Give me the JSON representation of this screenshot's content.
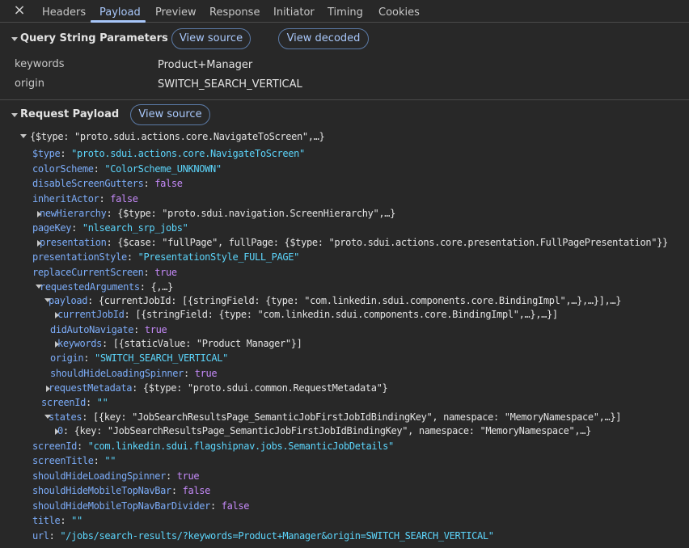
{
  "tabs": {
    "close_icon": "×",
    "items": [
      "Headers",
      "Payload",
      "Preview",
      "Response",
      "Initiator",
      "Timing",
      "Cookies"
    ],
    "active": "Payload",
    "accent": "#a8c7fa"
  },
  "query": {
    "title": "Query String Parameters",
    "view_source": "View source",
    "view_decoded": "View decoded",
    "params": [
      {
        "key": "keywords",
        "value": "Product+Manager"
      },
      {
        "key": "origin",
        "value": "SWITCH_SEARCH_VERTICAL"
      }
    ]
  },
  "payload": {
    "title": "Request Payload",
    "view_source": "View source",
    "root": "{$type: \"proto.sdui.actions.core.NavigateToScreen\",…}",
    "lines": [
      {
        "key": "$type",
        "val": "\"proto.sdui.actions.core.NavigateToScreen\"",
        "kind": "s"
      },
      {
        "key": "colorScheme",
        "val": "\"ColorScheme_UNKNOWN\"",
        "kind": "s"
      },
      {
        "key": "disableScreenGutters",
        "val": "false",
        "kind": "b"
      },
      {
        "key": "inheritActor",
        "val": "false",
        "kind": "b"
      },
      {
        "key": "newHierarchy",
        "val": "{$type: \"proto.sdui.navigation.ScreenHierarchy\",…}",
        "kind": "p"
      },
      {
        "key": "pageKey",
        "val": "\"nlsearch_srp_jobs\"",
        "kind": "s"
      },
      {
        "key": "presentation",
        "val": "{$case: \"fullPage\", fullPage: {$type: \"proto.sdui.actions.core.presentation.FullPagePresentation\"}}",
        "kind": "p"
      },
      {
        "key": "presentationStyle",
        "val": "\"PresentationStyle_FULL_PAGE\"",
        "kind": "s"
      },
      {
        "key": "replaceCurrentScreen",
        "val": "true",
        "kind": "b"
      },
      {
        "key": "requestedArguments",
        "val": "{,…}",
        "kind": "p"
      },
      {
        "key": "payload",
        "val": "{currentJobId: [{stringField: {type: \"com.linkedin.sdui.components.core.BindingImpl\",…},…}],…}",
        "kind": "p"
      },
      {
        "key": "currentJobId",
        "val": "[{stringField: {type: \"com.linkedin.sdui.components.core.BindingImpl\",…},…}]",
        "kind": "p"
      },
      {
        "key": "didAutoNavigate",
        "val": "true",
        "kind": "b"
      },
      {
        "key": "keywords",
        "val": "[{staticValue: \"Product Manager\"}]",
        "kind": "p"
      },
      {
        "key": "origin",
        "val": "\"SWITCH_SEARCH_VERTICAL\"",
        "kind": "s"
      },
      {
        "key": "shouldHideLoadingSpinner",
        "val": "true",
        "kind": "b"
      },
      {
        "key": "requestMetadata",
        "val": "{$type: \"proto.sdui.common.RequestMetadata\"}",
        "kind": "p"
      },
      {
        "key": "screenId",
        "val": "\"\"",
        "kind": "s"
      },
      {
        "key": "states",
        "val": "[{key: \"JobSearchResultsPage_SemanticJobFirstJobIdBindingKey\", namespace: \"MemoryNamespace\",…}]",
        "kind": "p"
      },
      {
        "key": "0",
        "val": "{key: \"JobSearchResultsPage_SemanticJobFirstJobIdBindingKey\", namespace: \"MemoryNamespace\",…}",
        "kind": "p"
      },
      {
        "key": "screenId",
        "val": "\"com.linkedin.sdui.flagshipnav.jobs.SemanticJobDetails\"",
        "kind": "s"
      },
      {
        "key": "screenTitle",
        "val": "\"\"",
        "kind": "s"
      },
      {
        "key": "shouldHideLoadingSpinner",
        "val": "true",
        "kind": "b"
      },
      {
        "key": "shouldHideMobileTopNavBar",
        "val": "false",
        "kind": "b"
      },
      {
        "key": "shouldHideMobileTopNavBarDivider",
        "val": "false",
        "kind": "b"
      },
      {
        "key": "title",
        "val": "\"\"",
        "kind": "s"
      },
      {
        "key": "url",
        "val": "\"/jobs/search-results/?keywords=Product+Manager&origin=SWITCH_SEARCH_VERTICAL\"",
        "kind": "s"
      }
    ]
  }
}
